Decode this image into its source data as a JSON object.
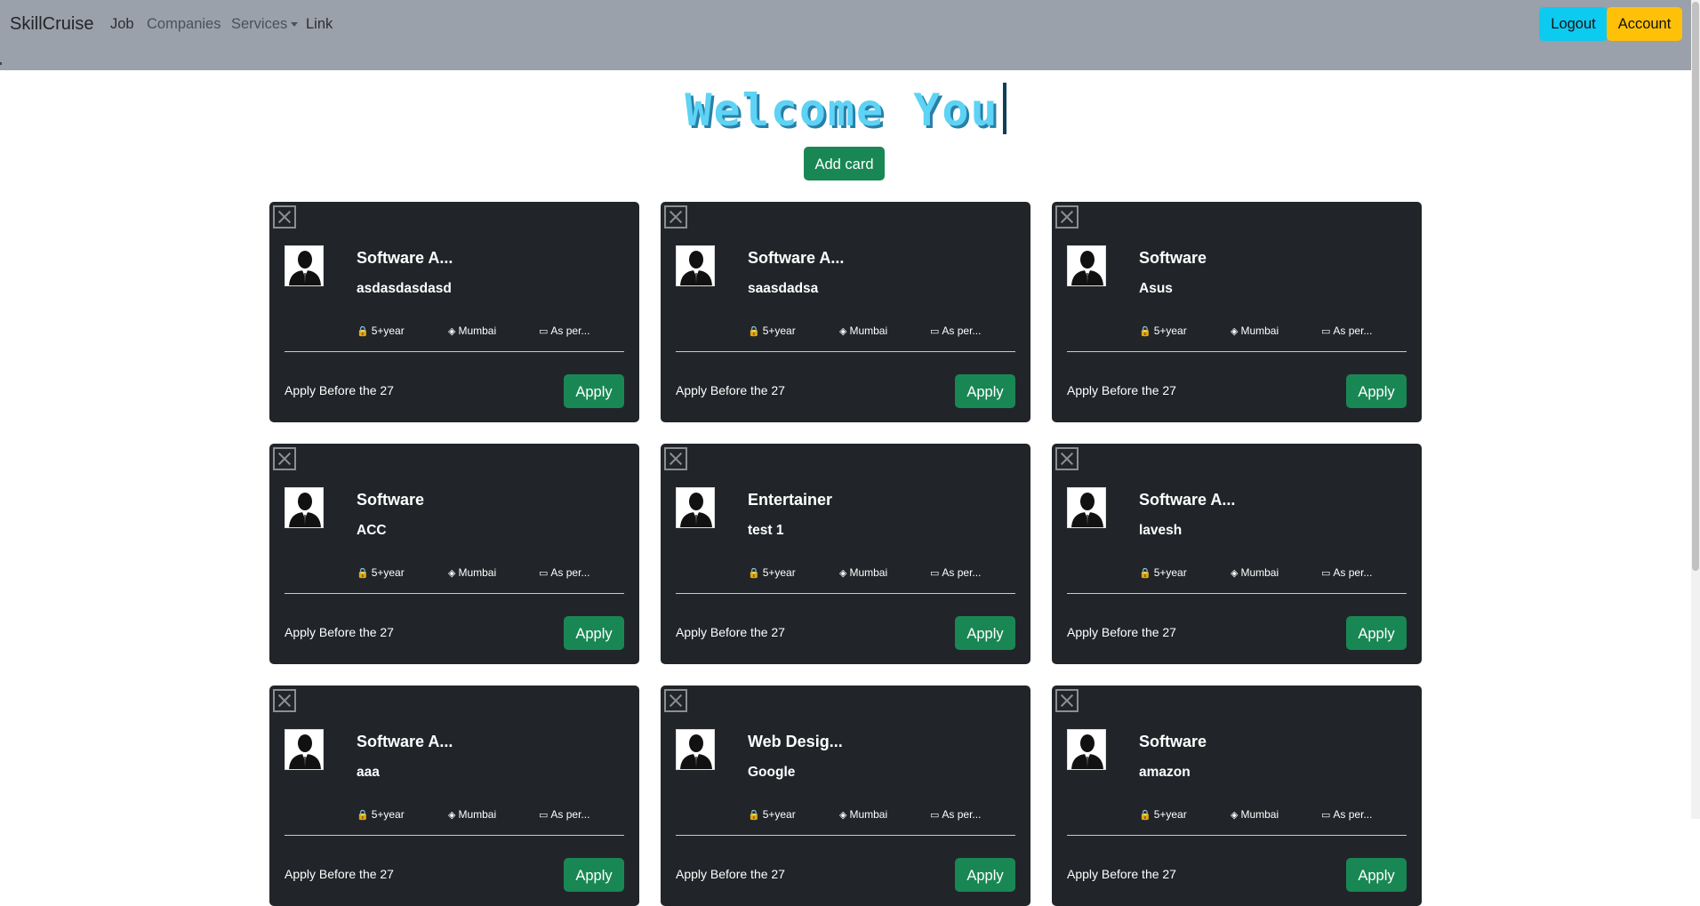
{
  "navbar": {
    "brand": "SkillCruise",
    "links": [
      {
        "label": "Job"
      },
      {
        "label": "Companies"
      },
      {
        "label": "Services"
      },
      {
        "label": "Link"
      }
    ],
    "logout_label": "Logout",
    "account_label": "Account"
  },
  "hero": {
    "title": "Welcome You",
    "add_card_label": "Add card"
  },
  "colors": {
    "navbar_bg": "#9aa1aa",
    "card_bg": "#212529",
    "success": "#198754",
    "info": "#0dcaf0",
    "warning": "#ffc107",
    "title": "#5dd3f5"
  },
  "cards": [
    {
      "title": "Software A...",
      "company": "asdasdasdasd",
      "experience": "5+year",
      "location": "Mumbai",
      "salary": "As per...",
      "deadline": "Apply Before the 27",
      "apply_label": "Apply"
    },
    {
      "title": "Software A...",
      "company": "saasdadsa",
      "experience": "5+year",
      "location": "Mumbai",
      "salary": "As per...",
      "deadline": "Apply Before the 27",
      "apply_label": "Apply"
    },
    {
      "title": "Software",
      "company": "Asus",
      "experience": "5+year",
      "location": "Mumbai",
      "salary": "As per...",
      "deadline": "Apply Before the 27",
      "apply_label": "Apply"
    },
    {
      "title": "Software",
      "company": "ACC",
      "experience": "5+year",
      "location": "Mumbai",
      "salary": "As per...",
      "deadline": "Apply Before the 27",
      "apply_label": "Apply"
    },
    {
      "title": "Entertainer",
      "company": "test 1",
      "experience": "5+year",
      "location": "Mumbai",
      "salary": "As per...",
      "deadline": "Apply Before the 27",
      "apply_label": "Apply"
    },
    {
      "title": "Software A...",
      "company": "lavesh",
      "experience": "5+year",
      "location": "Mumbai",
      "salary": "As per...",
      "deadline": "Apply Before the 27",
      "apply_label": "Apply"
    },
    {
      "title": "Software A...",
      "company": "aaa",
      "experience": "5+year",
      "location": "Mumbai",
      "salary": "As per...",
      "deadline": "Apply Before the 27",
      "apply_label": "Apply"
    },
    {
      "title": "Web Desig...",
      "company": "Google",
      "experience": "5+year",
      "location": "Mumbai",
      "salary": "As per...",
      "deadline": "Apply Before the 27",
      "apply_label": "Apply"
    },
    {
      "title": "Software",
      "company": "amazon",
      "experience": "5+year",
      "location": "Mumbai",
      "salary": "As per...",
      "deadline": "Apply Before the 27",
      "apply_label": "Apply"
    }
  ]
}
